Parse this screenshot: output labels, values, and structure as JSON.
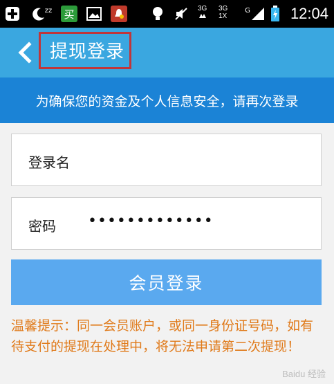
{
  "status_bar": {
    "time": "12:04",
    "network_1": "3G",
    "network_2": "3G",
    "network_2b": "1X",
    "network_3": "G",
    "app_icon_label": "买",
    "sleep_icon_label": "zz"
  },
  "header": {
    "title": "提现登录"
  },
  "notice": {
    "text": "为确保您的资金及个人信息安全，请再次登录"
  },
  "form": {
    "username_label": "登录名",
    "username_value": "",
    "password_label": "密码",
    "password_value": "•••••••••••••"
  },
  "button": {
    "label": "会员登录"
  },
  "tip": {
    "text": "温馨提示：同一会员账户，或同一身份证号码，如有待支付的提现在处理中，将无法申请第二次提现！"
  },
  "watermark": {
    "text": "Baidu 经验"
  },
  "colors": {
    "header": "#3aa7e0",
    "notice": "#1b83d6",
    "button": "#5aa9ef",
    "tip": "#e07a1a",
    "highlight": "#c0363a"
  }
}
